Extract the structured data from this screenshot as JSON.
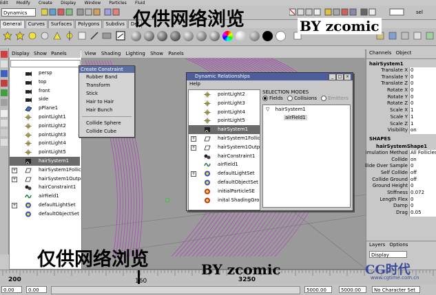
{
  "menubar": [
    "Edit",
    "Modify",
    "Create",
    "Display",
    "Window",
    "Particles",
    "Fluid"
  ],
  "status": {
    "menu_set": "Dynamics",
    "sel_label": "sel"
  },
  "shelf_tabs": [
    "General",
    "Curves",
    "Surfaces",
    "Polygons",
    "Subdivs",
    "Def"
  ],
  "outliner": {
    "menu": [
      "Display",
      "Show",
      "Panels"
    ],
    "items": [
      {
        "label": "persp",
        "icon": "camera-icon"
      },
      {
        "label": "top",
        "icon": "camera-icon"
      },
      {
        "label": "front",
        "icon": "camera-icon"
      },
      {
        "label": "side",
        "icon": "camera-icon"
      },
      {
        "label": "pPlane1",
        "icon": "plane-icon"
      },
      {
        "label": "pointLight1",
        "icon": "point-light-icon"
      },
      {
        "label": "pointLight2",
        "icon": "point-light-icon"
      },
      {
        "label": "pointLight3",
        "icon": "point-light-icon"
      },
      {
        "label": "pointLight4",
        "icon": "point-light-icon"
      },
      {
        "label": "pointLight5",
        "icon": "point-light-icon"
      },
      {
        "label": "hairSystem1",
        "icon": "hair-system-icon",
        "selected": true
      },
      {
        "label": "hairSystem1Follicle",
        "icon": "group-icon",
        "expand": true
      },
      {
        "label": "hairSystem1Outpu",
        "icon": "group-icon",
        "expand": true
      },
      {
        "label": "hairConstraint1",
        "icon": "constraint-icon"
      },
      {
        "label": "airField1",
        "icon": "air-field-icon"
      },
      {
        "label": "defaultLightSet",
        "icon": "set-icon",
        "expand": true
      },
      {
        "label": "defaultObjectSet",
        "icon": "set-icon"
      }
    ]
  },
  "viewport_menu": [
    "View",
    "Shading",
    "Lighting",
    "Show",
    "Panels"
  ],
  "create_constraint": {
    "title": "Create Constraint",
    "items": [
      "Rubber Band",
      "Transform",
      "Stick",
      "Hair to Hair",
      "Hair Bunch"
    ],
    "items2": [
      "Collide Sphere",
      "Collide Cube"
    ]
  },
  "dynamic_relationships": {
    "title": "Dynamic Relationships",
    "menu": "Help",
    "list": [
      {
        "label": "pointLight2",
        "icon": "point-light-icon"
      },
      {
        "label": "pointLight3",
        "icon": "point-light-icon"
      },
      {
        "label": "pointLight4",
        "icon": "point-light-icon"
      },
      {
        "label": "pointLight5",
        "icon": "point-light-icon"
      },
      {
        "label": "hairSystem1",
        "icon": "hair-system-icon",
        "selected": true
      },
      {
        "label": "hairSystem1Follic",
        "icon": "group-icon",
        "expand": true
      },
      {
        "label": "hairSystem1Outp",
        "icon": "group-icon",
        "expand": true
      },
      {
        "label": "hairConstraint1",
        "icon": "constraint-icon"
      },
      {
        "label": "airField1",
        "icon": "air-field-icon"
      },
      {
        "label": "defaultLightSet",
        "icon": "set-icon",
        "expand": true
      },
      {
        "label": "defaultObjectSet",
        "icon": "set-icon"
      },
      {
        "label": "initialParticleSE",
        "icon": "shading-group-icon"
      },
      {
        "label": "inital ShadingGro",
        "icon": "shading-group-icon"
      }
    ],
    "modes_title": "SELECTION MODES",
    "modes": [
      "Fields",
      "Collisions",
      "Emitters"
    ],
    "tree_root": "hairSystem1",
    "tree_child": "airField1"
  },
  "channel_box": {
    "menu": [
      "Channels",
      "Object"
    ],
    "node": "hairSystem1",
    "channels": [
      [
        "Translate X",
        "0"
      ],
      [
        "Translate Y",
        "0"
      ],
      [
        "Translate Z",
        "0"
      ],
      [
        "Rotate X",
        "0"
      ],
      [
        "Rotate Y",
        "0"
      ],
      [
        "Rotate Z",
        "0"
      ],
      [
        "Scale X",
        "1"
      ],
      [
        "Scale Y",
        "1"
      ],
      [
        "Scale Z",
        "1"
      ],
      [
        "Visibility",
        "on"
      ]
    ],
    "shapes_label": "SHAPES",
    "shape_node": "hairSystemShape1",
    "shape_channels": [
      [
        "imulation Method",
        "All Follicles"
      ],
      [
        "Collide",
        "on"
      ],
      [
        "llide Over Sample",
        "0"
      ],
      [
        "Self Collide",
        "off"
      ],
      [
        "Collide Ground",
        "off"
      ],
      [
        "Ground Height",
        "0"
      ],
      [
        "Stiffness",
        "0.072"
      ],
      [
        "Length Flex",
        "0"
      ],
      [
        "Damp",
        "0"
      ],
      [
        "Drag",
        "0.05"
      ]
    ]
  },
  "layers": {
    "menu": [
      "Layers",
      "Options"
    ],
    "display": "Display"
  },
  "timeline": {
    "ticks": [
      "200",
      "",
      "",
      "",
      "",
      "",
      "",
      "",
      "",
      "",
      "",
      "",
      "",
      "",
      "3250"
    ],
    "current": "160"
  },
  "range": {
    "start": "0.00",
    "end": "5000.00",
    "char_set": "No Character Set",
    "end2": "5000.00"
  },
  "watermark": {
    "top": "仅供网络浏览",
    "top_by": "BY zcomic",
    "bottom": "仅供网络浏览",
    "bottom_by": "BY zcomic",
    "logo": "CG时代",
    "url": "www.cgtime.com.cn"
  },
  "colors": {
    "selected": "#6b6b6b",
    "title_bar": "#4e5e9a",
    "hair": "#b040c0"
  }
}
